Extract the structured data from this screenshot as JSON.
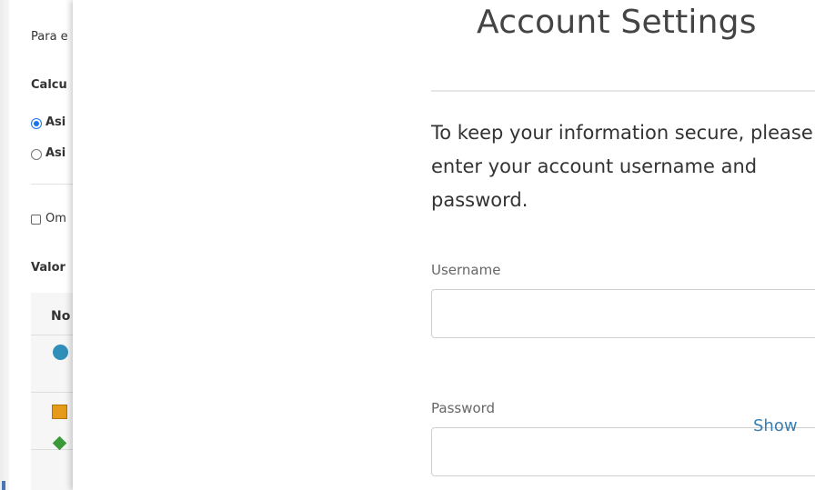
{
  "background_page": {
    "intro_text": "Para e",
    "section_heading": "Calcu",
    "options": [
      {
        "label": "Asi",
        "selected": true
      },
      {
        "label": "Asi",
        "selected": false
      }
    ],
    "checkbox_label": "Om",
    "values_heading": "Valor",
    "table_header": "No",
    "row_icons": [
      "circle-icon",
      "square-icon",
      "diamond-icon"
    ],
    "colors": {
      "circle": "#2f8fb8",
      "square": "#e69a1a",
      "diamond": "#3a9a3a"
    }
  },
  "dialog": {
    "title": "Account Settings",
    "message": "To keep your information secure, please enter your account username and password.",
    "username": {
      "label": "Username",
      "value": ""
    },
    "password": {
      "label": "Password",
      "value": "",
      "show_label": "Show"
    },
    "accent_color": "#3a7fb0"
  }
}
